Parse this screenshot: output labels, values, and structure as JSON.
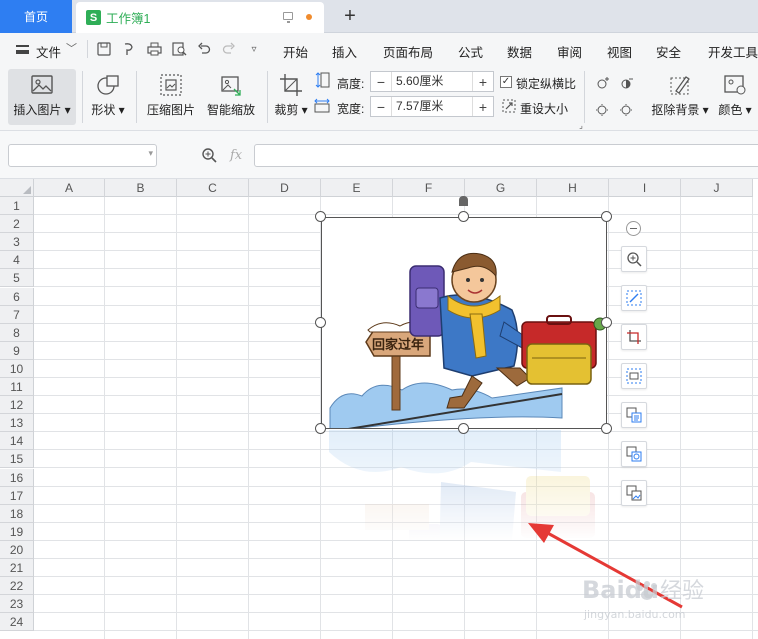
{
  "tabs": {
    "home": "首页",
    "doc_icon": "S",
    "doc_title": "工作簿1",
    "new_tab": "+"
  },
  "menu": {
    "file": "文件",
    "items": [
      "开始",
      "插入",
      "页面布局",
      "公式",
      "数据",
      "审阅",
      "视图",
      "安全",
      "开发工具"
    ]
  },
  "ribbon": {
    "insert_picture": "插入图片",
    "shape": "形状",
    "compress_picture": "压缩图片",
    "smart_scale": "智能缩放",
    "crop": "裁剪",
    "height_label": "高度:",
    "height_value": "5.60厘米",
    "width_label": "宽度:",
    "width_value": "7.57厘米",
    "lock_ratio": "锁定纵横比",
    "lock_ratio_checked": true,
    "reset_size": "重设大小",
    "remove_bg": "抠除背景",
    "color": "颜色"
  },
  "formula_bar": {
    "name_box": "",
    "fx": "fx",
    "formula": ""
  },
  "sheet": {
    "columns": [
      "A",
      "B",
      "C",
      "D",
      "E",
      "F",
      "G",
      "H",
      "I",
      "J"
    ],
    "rows": [
      "1",
      "2",
      "3",
      "4",
      "5",
      "6",
      "7",
      "8",
      "9",
      "10",
      "11",
      "12",
      "13",
      "14",
      "15",
      "16",
      "17",
      "18",
      "19",
      "20",
      "21",
      "22",
      "23",
      "24"
    ]
  },
  "picture": {
    "sign_text": "回家过年"
  },
  "watermark": {
    "brand": "Baidu",
    "brand_cn": "经验",
    "url": "jingyan.baidu.com"
  },
  "colors": {
    "accent": "#2e7ef2",
    "doc_green": "#2fae57",
    "arrow_red": "#e53935"
  }
}
